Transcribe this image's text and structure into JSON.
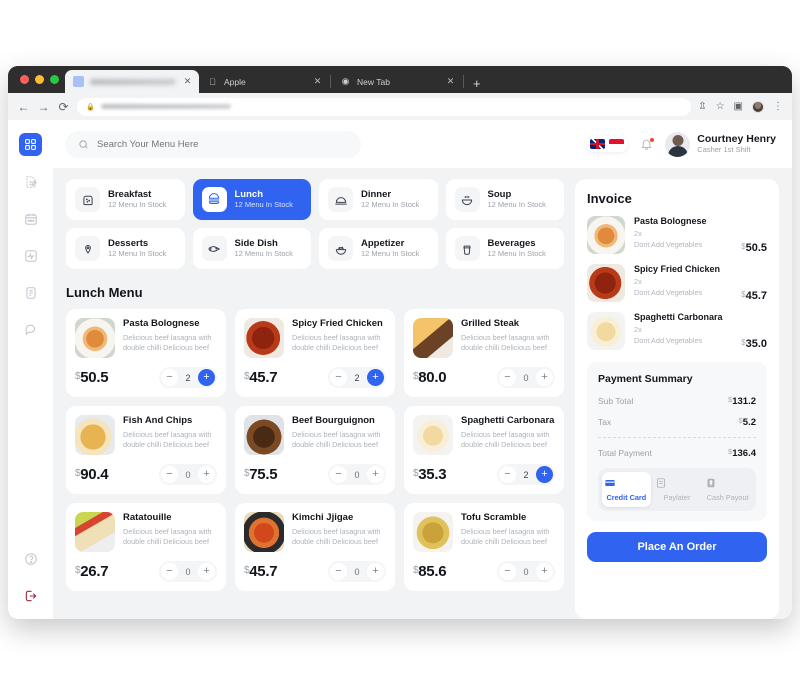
{
  "browser": {
    "tabs": [
      {
        "title": "",
        "blurred": true,
        "favicon": "page-icon",
        "active": true
      },
      {
        "title": "Apple",
        "blurred": false,
        "favicon": "apple-icon",
        "active": false
      },
      {
        "title": "New Tab",
        "blurred": false,
        "favicon": "globe-icon",
        "active": false
      }
    ],
    "new_tab_label": "+",
    "address_blurred": true,
    "nav": {
      "back": "←",
      "forward": "→",
      "reload": "⟳"
    },
    "toolbar_icons": [
      "share-icon",
      "bookmark-star-icon",
      "side-panel-icon",
      "profile-avatar",
      "kebab-menu-icon"
    ]
  },
  "sidebar": {
    "items": [
      {
        "name": "dashboard",
        "icon": "grid-icon",
        "active": true
      },
      {
        "name": "orders",
        "icon": "edit-note-icon",
        "active": false
      },
      {
        "name": "calendar",
        "icon": "calendar-icon",
        "active": false
      },
      {
        "name": "analytics",
        "icon": "activity-icon",
        "active": false
      },
      {
        "name": "reports",
        "icon": "document-icon",
        "active": false
      },
      {
        "name": "messages",
        "icon": "chat-icon",
        "active": false
      }
    ],
    "bottom": [
      {
        "name": "help",
        "icon": "help-circle-icon"
      },
      {
        "name": "logout",
        "icon": "logout-icon"
      }
    ]
  },
  "topbar": {
    "search_placeholder": "Search Your Menu Here",
    "search_value": "",
    "languages": [
      "flag-uk",
      "flag-indonesia"
    ],
    "notification_icon": "bell-icon",
    "has_notification": true,
    "user": {
      "name": "Courtney Henry",
      "role": "Casher 1st Shift"
    }
  },
  "categories": [
    {
      "name": "Breakfast",
      "stock": "12 Menu In Stock",
      "icon": "bread-icon",
      "selected": false
    },
    {
      "name": "Lunch",
      "stock": "12 Menu In Stock",
      "icon": "burger-icon",
      "selected": true
    },
    {
      "name": "Dinner",
      "stock": "12 Menu In Stock",
      "icon": "cloche-icon",
      "selected": false
    },
    {
      "name": "Soup",
      "stock": "12 Menu In Stock",
      "icon": "soup-bowl-icon",
      "selected": false
    },
    {
      "name": "Desserts",
      "stock": "12 Menu In Stock",
      "icon": "ice-cream-icon",
      "selected": false
    },
    {
      "name": "Side Dish",
      "stock": "12 Menu In Stock",
      "icon": "fish-icon",
      "selected": false
    },
    {
      "name": "Appetizer",
      "stock": "12 Menu In Stock",
      "icon": "salad-bowl-icon",
      "selected": false
    },
    {
      "name": "Beverages",
      "stock": "12 Menu In Stock",
      "icon": "coffee-cup-icon",
      "selected": false
    }
  ],
  "menu": {
    "title": "Lunch Menu",
    "items": [
      {
        "name": "Pasta Bolognese",
        "desc": "Delicious beef lasagna with double chilli Delicious beef",
        "currency": "$",
        "price": "50.5",
        "qty": "2"
      },
      {
        "name": "Spicy Fried Chicken",
        "desc": "Delicious beef lasagna with double chilli Delicious beef",
        "currency": "$",
        "price": "45.7",
        "qty": "2"
      },
      {
        "name": "Grilled Steak",
        "desc": "Delicious beef lasagna with double chilli Delicious beef",
        "currency": "$",
        "price": "80.0",
        "qty": "0"
      },
      {
        "name": "Fish And Chips",
        "desc": "Delicious beef lasagna with double chilli Delicious beef",
        "currency": "$",
        "price": "90.4",
        "qty": "0"
      },
      {
        "name": "Beef Bourguignon",
        "desc": "Delicious beef lasagna with double chilli Delicious beef",
        "currency": "$",
        "price": "75.5",
        "qty": "0"
      },
      {
        "name": "Spaghetti Carbonara",
        "desc": "Delicious beef lasagna with double chilli Delicious beef",
        "currency": "$",
        "price": "35.3",
        "qty": "2"
      },
      {
        "name": "Ratatouille",
        "desc": "Delicious beef lasagna with double chilli Delicious beef",
        "currency": "$",
        "price": "26.7",
        "qty": "0"
      },
      {
        "name": "Kimchi Jjigae",
        "desc": "Delicious beef lasagna with double chilli Delicious beef",
        "currency": "$",
        "price": "45.7",
        "qty": "0"
      },
      {
        "name": "Tofu Scramble",
        "desc": "Delicious beef lasagna with double chilli Delicious beef",
        "currency": "$",
        "price": "85.6",
        "qty": "0"
      }
    ],
    "decrement_label": "−",
    "increment_label": "+"
  },
  "invoice": {
    "title": "Invoice",
    "items": [
      {
        "name": "Pasta Bolognese",
        "qty": "2x",
        "note": "Dont Add Vegetables",
        "currency": "$",
        "price": "50.5"
      },
      {
        "name": "Spicy Fried Chicken",
        "qty": "2x",
        "note": "Dont Add Vegetables",
        "currency": "$",
        "price": "45.7"
      },
      {
        "name": "Spaghetti Carbonara",
        "qty": "2x",
        "note": "Dont Add Vegetables",
        "currency": "$",
        "price": "35.0"
      }
    ],
    "summary": {
      "title": "Payment Summary",
      "subtotal_label": "Sub Total",
      "subtotal_currency": "$",
      "subtotal_value": "131.2",
      "tax_label": "Tax",
      "tax_currency": "$",
      "tax_value": "5.2",
      "total_label": "Total Payment",
      "total_currency": "$",
      "total_value": "136.4"
    },
    "payment_methods": [
      {
        "label": "Credit Card",
        "icon": "credit-card-icon",
        "selected": true
      },
      {
        "label": "Paylater",
        "icon": "receipt-icon",
        "selected": false
      },
      {
        "label": "Cash Payout",
        "icon": "cash-icon",
        "selected": false
      }
    ],
    "order_button": "Place An Order"
  },
  "colors": {
    "accent": "#2F63F0",
    "page_bg": "#F2F3F5",
    "card_bg": "#FFFFFF",
    "text_primary": "#12161C",
    "text_muted": "#9BA1A9",
    "logout": "#9B2D3A"
  }
}
